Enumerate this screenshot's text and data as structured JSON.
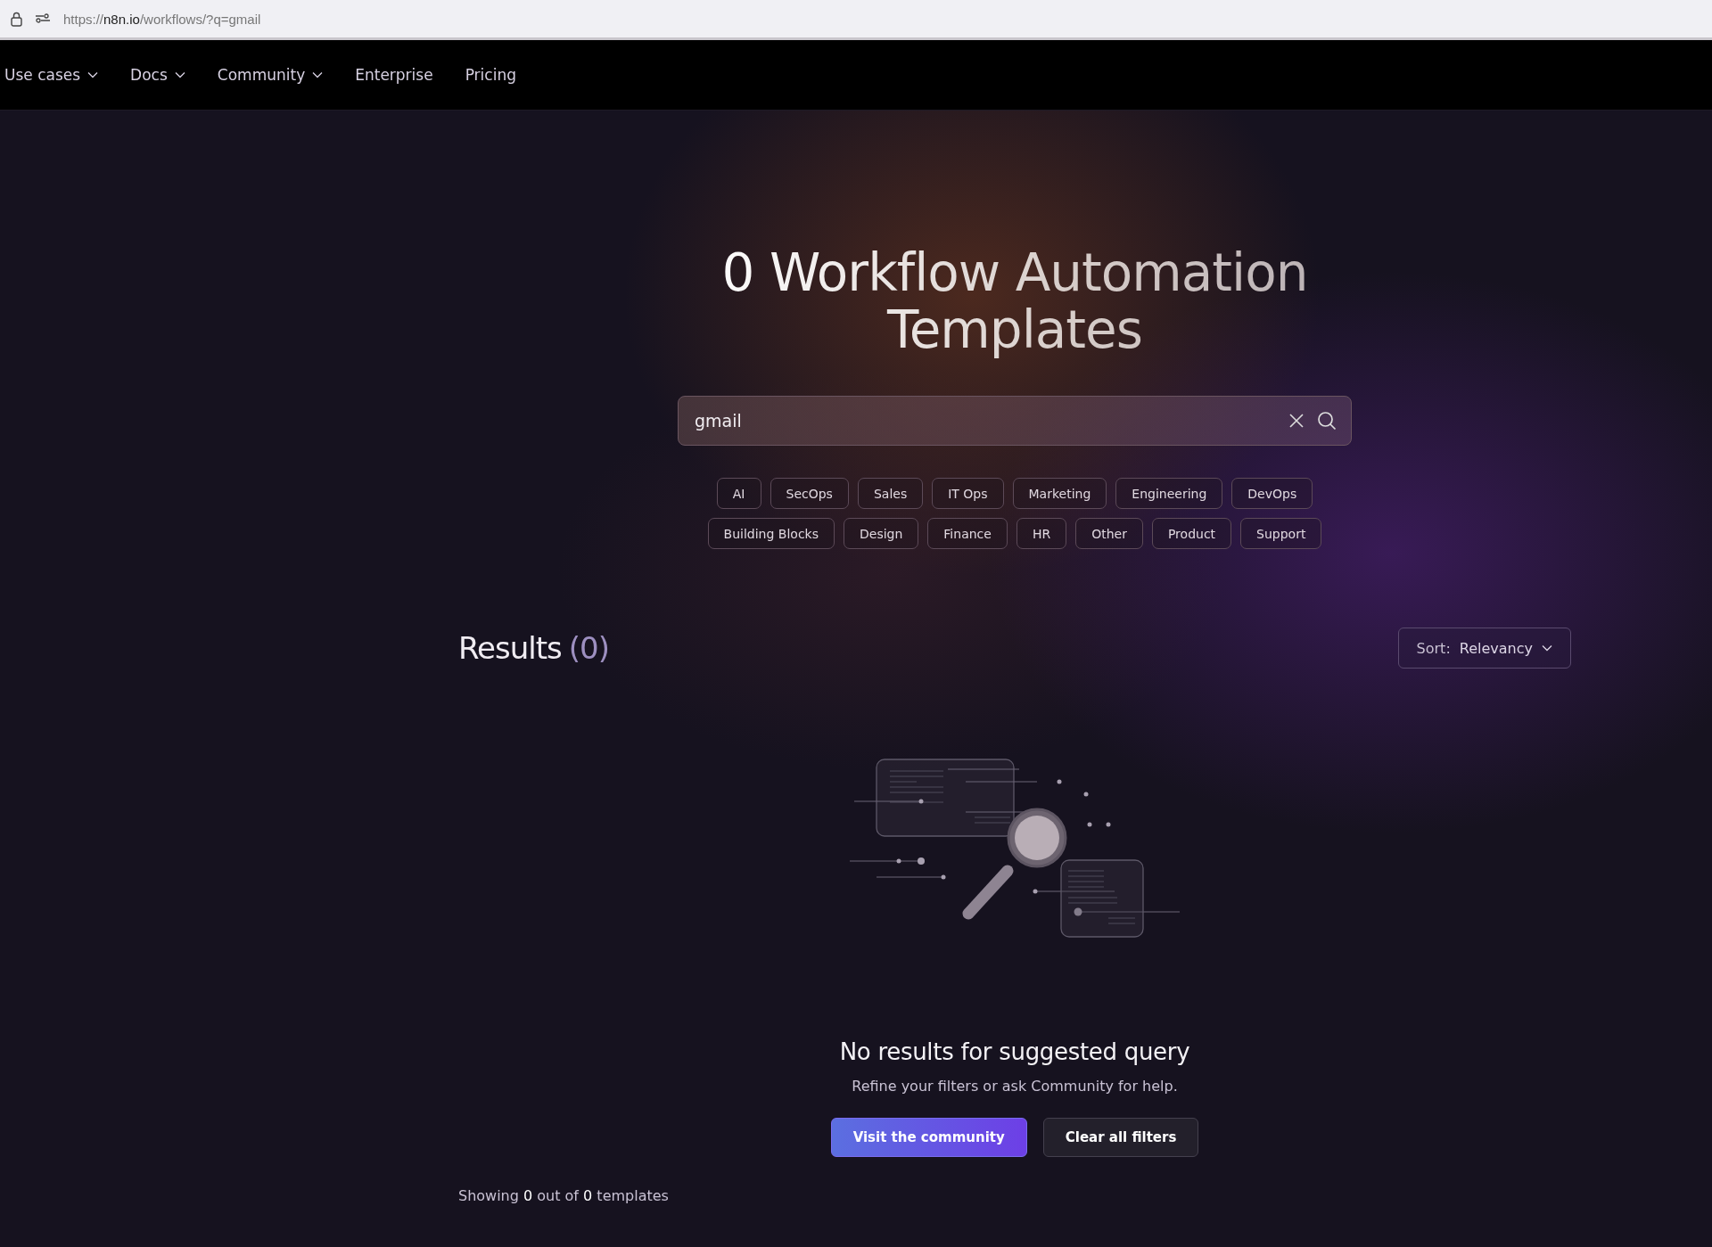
{
  "browser": {
    "url": "https://**n8n.io**/workflows/?q=gmail"
  },
  "nav": [
    {
      "label": "Use cases",
      "kind": "dropdown"
    },
    {
      "label": "Docs",
      "kind": "dropdown"
    },
    {
      "label": "Community",
      "kind": "dropdown"
    },
    {
      "label": "Enterprise",
      "kind": "link"
    },
    {
      "label": "Pricing",
      "kind": "link"
    }
  ],
  "hero": {
    "title": "0 Workflow Automation Templates",
    "search": {
      "value": "gmail"
    },
    "categories": [
      [
        "AI",
        "SecOps",
        "Sales",
        "IT Ops",
        "Marketing",
        "Engineering",
        "DevOps"
      ],
      [
        "Building Blocks",
        "Design",
        "Finance",
        "HR",
        "Other",
        "Product",
        "Support"
      ]
    ]
  },
  "results": {
    "label": "Results",
    "count": "(0)",
    "sort_label": "Sort:",
    "sort_value": "Relevancy"
  },
  "empty": {
    "title": "No results for suggested query",
    "text": "Refine your filters or ask Community for help.",
    "buttons": [
      {
        "label": "Visit the community",
        "kind": "primary"
      },
      {
        "label": "Clear all filters",
        "kind": "secondary"
      }
    ]
  },
  "footer": {
    "showing": "Showing **0** out of **0** templates"
  }
}
